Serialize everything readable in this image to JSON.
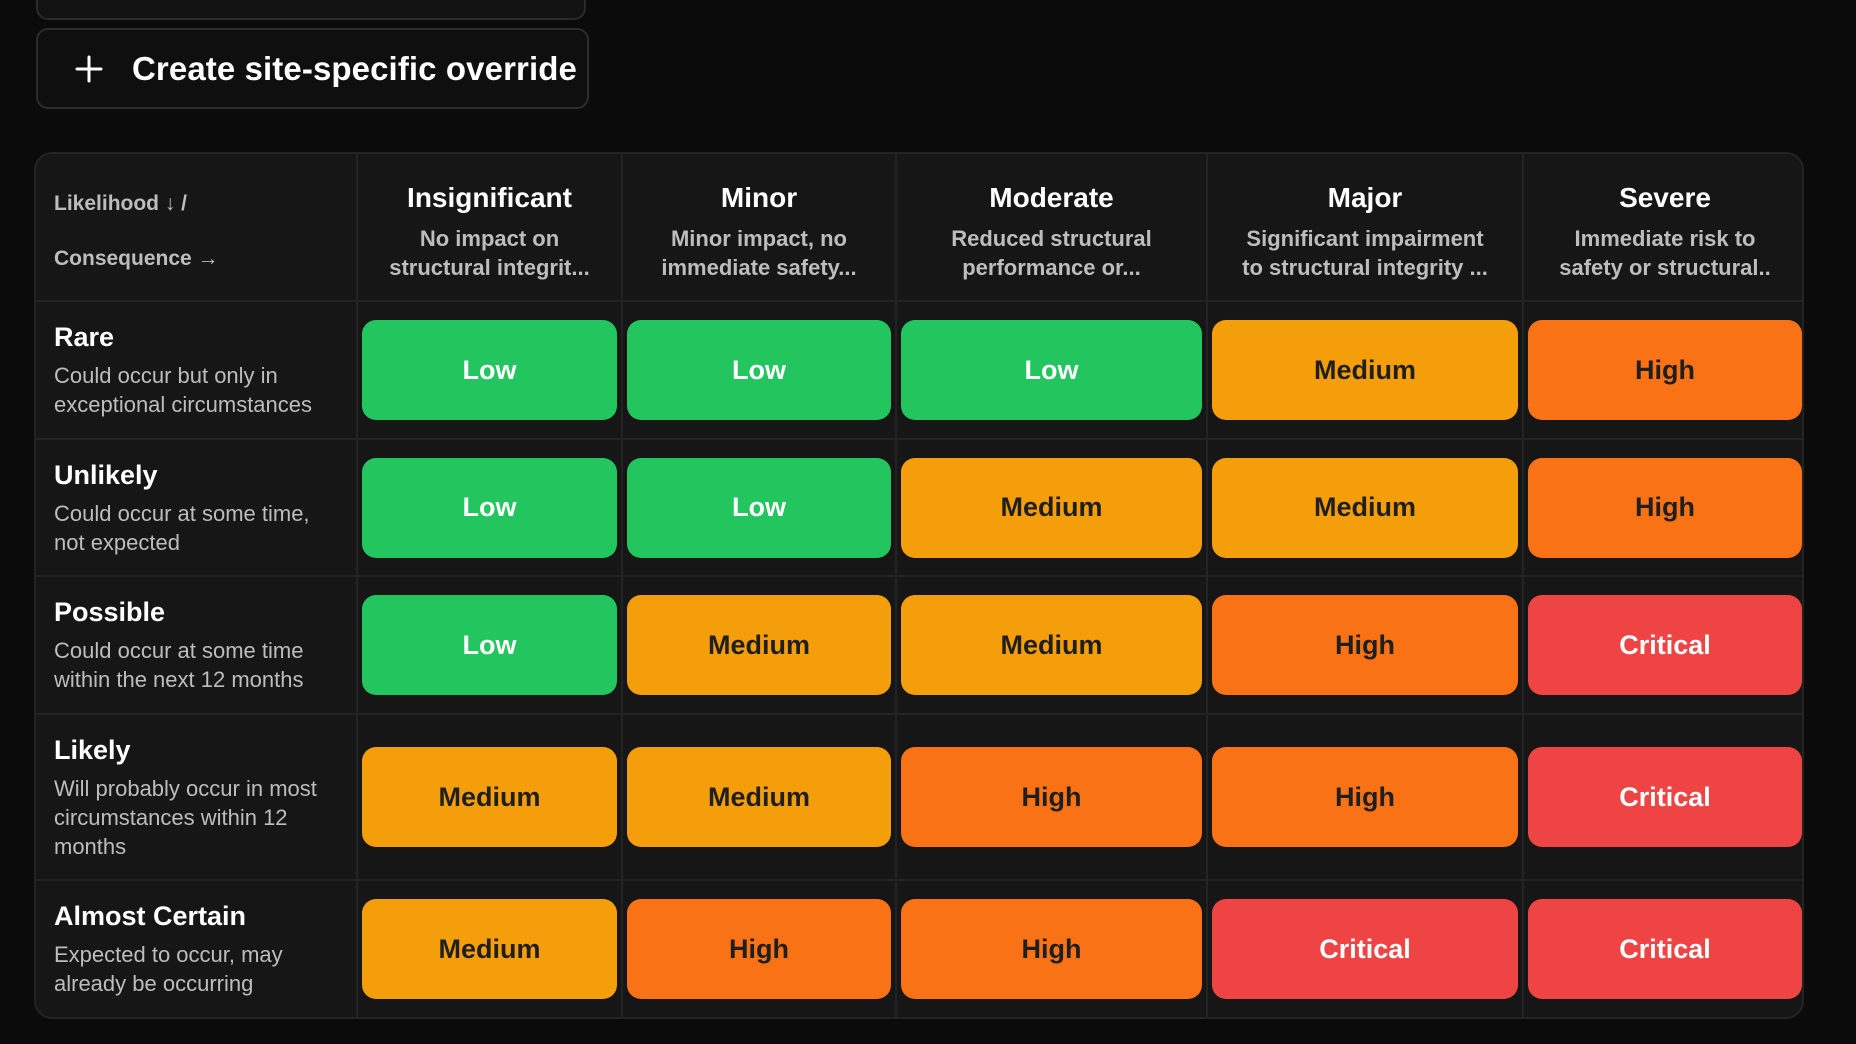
{
  "override_button": {
    "label": "Create site-specific override",
    "icon": "plus-icon"
  },
  "matrix": {
    "corner": {
      "line1": "Likelihood ↓ /",
      "line2": "Consequence →"
    },
    "consequences": [
      {
        "title": "Insignificant",
        "desc_line1": "No impact on",
        "desc_line2": "structural integrit..."
      },
      {
        "title": "Minor",
        "desc_line1": "Minor impact, no",
        "desc_line2": "immediate safety..."
      },
      {
        "title": "Moderate",
        "desc_line1": "Reduced structural",
        "desc_line2": "performance or..."
      },
      {
        "title": "Major",
        "desc_line1": "Significant impairment",
        "desc_line2": "to structural integrity ..."
      },
      {
        "title": "Severe",
        "desc_line1": "Immediate risk to",
        "desc_line2": "safety or structural.."
      }
    ],
    "likelihoods": [
      {
        "title": "Rare",
        "desc": "Could occur but only in exceptional circumstances"
      },
      {
        "title": "Unlikely",
        "desc": "Could occur at some time, not expected"
      },
      {
        "title": "Possible",
        "desc": "Could occur at some time within the next 12 months"
      },
      {
        "title": "Likely",
        "desc": "Will probably occur in most circumstances within 12 months"
      },
      {
        "title": "Almost Certain",
        "desc": "Expected to occur, may already be occurring"
      }
    ],
    "ratings": [
      [
        "Low",
        "Low",
        "Low",
        "Medium",
        "High"
      ],
      [
        "Low",
        "Low",
        "Medium",
        "Medium",
        "High"
      ],
      [
        "Low",
        "Medium",
        "Medium",
        "High",
        "Critical"
      ],
      [
        "Medium",
        "Medium",
        "High",
        "High",
        "Critical"
      ],
      [
        "Medium",
        "High",
        "High",
        "Critical",
        "Critical"
      ]
    ]
  },
  "colors": {
    "Low": "#22c55e",
    "Medium": "#f59e0b",
    "High": "#f97316",
    "Critical": "#ef4444",
    "background": "#0b0b0b",
    "panel": "#161616"
  }
}
